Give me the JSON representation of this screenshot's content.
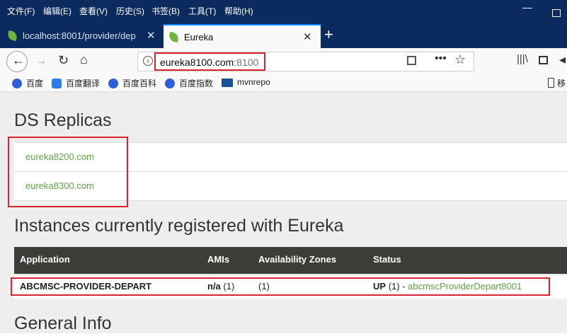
{
  "menu": [
    "文件(F)",
    "编辑(E)",
    "查看(V)",
    "历史(S)",
    "书签(B)",
    "工具(T)",
    "帮助(H)"
  ],
  "tabs": [
    {
      "label": "localhost:8001/provider/dep"
    },
    {
      "label": "Eureka"
    }
  ],
  "url": {
    "host": "eureka8100.com",
    "port": ":8100"
  },
  "bookmarks": [
    "百度",
    "百度翻译",
    "百度百科",
    "百度指数",
    "mvnrepo"
  ],
  "bookmark_right": "移",
  "page": {
    "ds_title": "DS Replicas",
    "replicas": [
      "eureka8200.com",
      "eureka8300.com"
    ],
    "instances_title": "Instances currently registered with Eureka",
    "columns": [
      "Application",
      "AMIs",
      "Availability Zones",
      "Status"
    ],
    "row": {
      "application": "ABCMSC-PROVIDER-DEPART",
      "amis_bold": "n/a",
      "amis_count": "(1)",
      "zones": "(1)",
      "status_bold": "UP",
      "status_count": "(1) -",
      "instance_link": "abcmscProviderDepart8001"
    },
    "general_title": "General Info"
  },
  "colors": {
    "link": "#5fa341",
    "highlight": "#d9232e",
    "header_bg": "#3d3c39"
  }
}
